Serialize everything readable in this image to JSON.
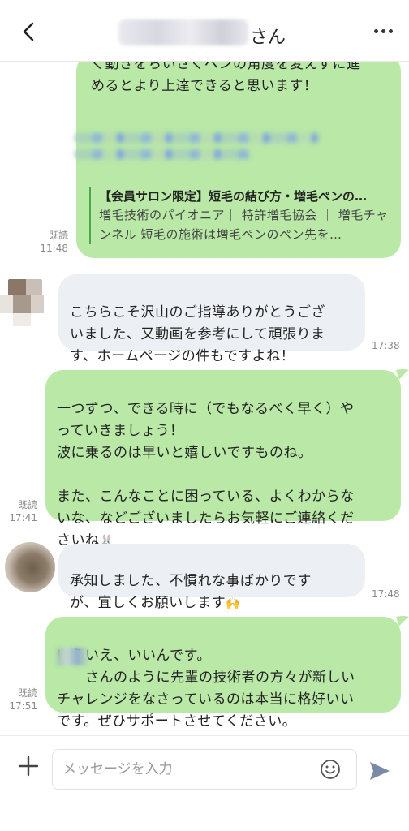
{
  "header": {
    "title_suffix": "さん"
  },
  "messages": [
    {
      "id": "m1",
      "side": "sent",
      "text": "く動きをちいさくペンの角度を変えずに進\nめるとより上達できると思います！",
      "link_preview": {
        "title": "【会員サロン限定】短毛の結び方・増毛ペンの…",
        "description": "増毛技術のパイオニア｜ 特許増毛協会 ｜ 増毛チャンネル 短毛の施術は増毛ペンのペン先を…"
      },
      "read": "既読",
      "time": "11:48"
    },
    {
      "id": "m2",
      "side": "recv",
      "text": "こちらこそ沢山のご指導ありがとうござ\nいました、又動画を参考にして頑張りま\nす、ホームページの件もですよね！",
      "time": "17:38"
    },
    {
      "id": "m3",
      "side": "sent",
      "text": "一つずつ、できる時に（でもなるべく早く）や\nっていきましょう！\n波に乗るのは早いと嬉しいですものね。\n\nまた、こんなことに困っている、よくわからな\nいな、などございましたらお気軽にご連絡くだ\nさいね",
      "emoji": "🐰",
      "read": "既読",
      "time": "17:41"
    },
    {
      "id": "m4",
      "side": "recv",
      "text": "承知しました、不慣れな事ばかりです\nが、宜しくお願いします",
      "emoji": "🙌",
      "time": "17:48"
    },
    {
      "id": "m5",
      "side": "sent",
      "text": "いえいえ、いいんです。\n　　さんのように先輩の技術者の方々が新しい\nチャレンジをなさっているのは本当に格好いい\nです。ぜひサポートさせてください。",
      "read": "既読",
      "time": "17:51"
    }
  ],
  "input": {
    "placeholder": "メッセージを入力"
  },
  "icons": {
    "back": "chevron-left-icon",
    "more": "more-horizontal-icon",
    "plus": "plus-icon",
    "emoji": "smiley-icon",
    "send": "send-icon"
  },
  "colors": {
    "sent_bubble": "#b9e8a7",
    "recv_bubble": "#eceff3",
    "send_icon": "#7a8aa6"
  }
}
